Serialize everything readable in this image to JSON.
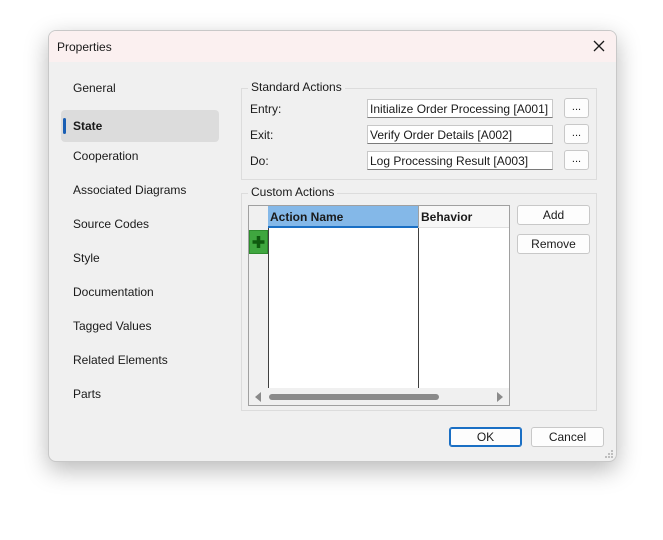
{
  "window": {
    "title": "Properties",
    "close_icon": "close-icon"
  },
  "sidebar": {
    "items": [
      {
        "label": "General",
        "active": false
      },
      {
        "label": "State",
        "active": true
      },
      {
        "label": "Cooperation",
        "active": false
      },
      {
        "label": "Associated Diagrams",
        "active": false
      },
      {
        "label": "Source Codes",
        "active": false
      },
      {
        "label": "Style",
        "active": false
      },
      {
        "label": "Documentation",
        "active": false
      },
      {
        "label": "Tagged Values",
        "active": false
      },
      {
        "label": "Related Elements",
        "active": false
      },
      {
        "label": "Parts",
        "active": false
      }
    ]
  },
  "standard_actions": {
    "title": "Standard Actions",
    "rows": [
      {
        "label": "Entry:",
        "value": "Initialize Order Processing  [A001]",
        "button": "..."
      },
      {
        "label": "Exit:",
        "value": "Verify Order Details [A002]",
        "button": "..."
      },
      {
        "label": "Do:",
        "value": "Log Processing Result [A003]",
        "button": "..."
      }
    ]
  },
  "custom_actions": {
    "title": "Custom Actions",
    "columns": [
      "Action Name",
      "Behavior"
    ],
    "rows": [],
    "add_row_icon": "plus-icon",
    "add_label": "Add",
    "remove_label": "Remove"
  },
  "footer": {
    "ok_label": "OK",
    "cancel_label": "Cancel"
  },
  "colors": {
    "accent": "#1a6fc4",
    "selected_header": "#84b8e8",
    "add_row": "#3fa63f"
  }
}
